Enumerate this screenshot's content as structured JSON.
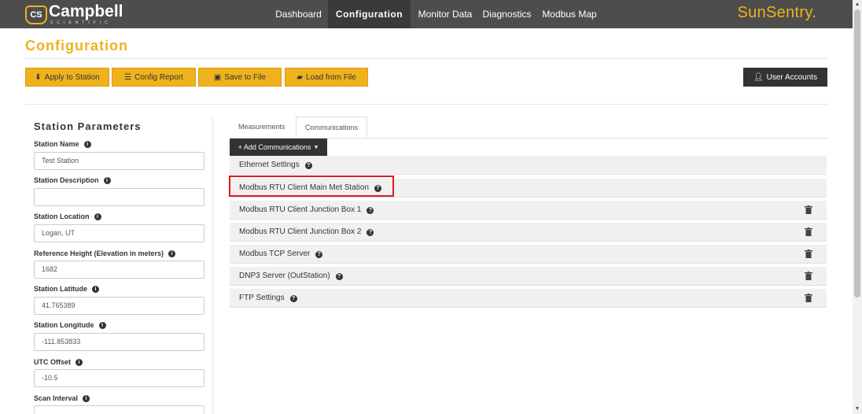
{
  "navbar": {
    "brand_badge": "CS",
    "brand_name": "Campbell",
    "brand_sub": "SCIENTIFIC",
    "items": [
      {
        "label": "Dashboard"
      },
      {
        "label": "Configuration",
        "active": true
      },
      {
        "label": "Monitor Data"
      },
      {
        "label": "Diagnostics"
      },
      {
        "label": "Modbus Map"
      }
    ],
    "product": "SunSentry."
  },
  "page": {
    "title": "Configuration"
  },
  "toolbar": {
    "apply_label": "Apply to Station",
    "report_label": "Config Report",
    "save_label": "Save to File",
    "load_label": "Load from File",
    "user_accounts_label": "User Accounts"
  },
  "station": {
    "section_title": "Station Parameters",
    "fields": [
      {
        "label": "Station Name",
        "value": ""
      },
      {
        "label": "Station Description",
        "value": ""
      },
      {
        "label": "Station Location",
        "value": ""
      },
      {
        "label": "Reference Height (Elevation in meters)",
        "value": "1682"
      },
      {
        "label": "Station Latitude",
        "value": "41.765389"
      },
      {
        "label": "Station Longitude",
        "value": "-111.853833"
      },
      {
        "label": "UTC Offset",
        "value": "-10.5"
      },
      {
        "label": "Scan Interval",
        "value": ""
      }
    ],
    "placeholders": {
      "name": "Test Station",
      "location": "Logan, UT"
    }
  },
  "tabs": [
    {
      "label": "Measurements"
    },
    {
      "label": "Communications",
      "active": true
    }
  ],
  "communications": {
    "add_label": "+ Add Communications",
    "rows": [
      {
        "label": "Ethernet Settings",
        "deletable": false
      },
      {
        "label": "Modbus RTU Client Main Met Station",
        "deletable": false,
        "highlighted": true
      },
      {
        "label": "Modbus RTU Client Junction Box 1",
        "deletable": true
      },
      {
        "label": "Modbus RTU Client Junction Box 2",
        "deletable": true
      },
      {
        "label": "Modbus TCP Server",
        "deletable": true
      },
      {
        "label": "DNP3 Server (OutStation)",
        "deletable": true
      },
      {
        "label": "FTP Settings",
        "deletable": true
      }
    ]
  },
  "colors": {
    "accent": "#f0b21c",
    "navbar": "#4d4d4d",
    "highlight": "#e01b1b"
  }
}
